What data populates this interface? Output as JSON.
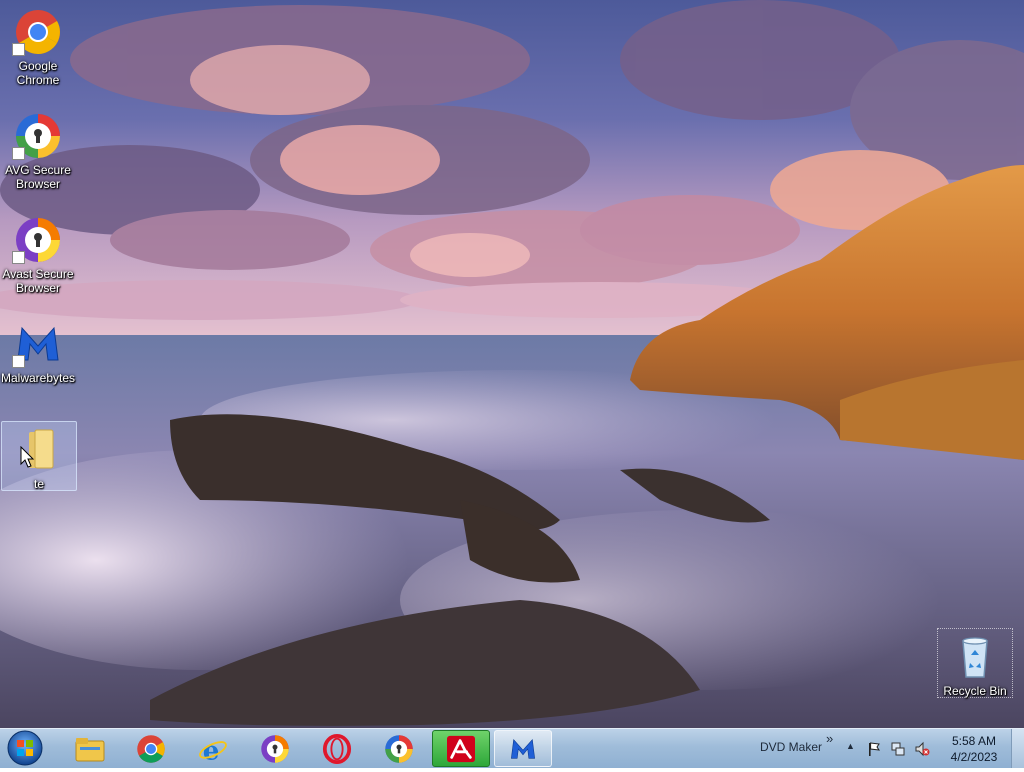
{
  "desktop": {
    "icons": [
      {
        "label": "Google\nChrome",
        "icon": "chrome-icon"
      },
      {
        "label": "AVG Secure\nBrowser",
        "icon": "avg-secure-browser-icon"
      },
      {
        "label": "Avast Secure\nBrowser",
        "icon": "avast-secure-browser-icon"
      },
      {
        "label": "Malwarebytes",
        "icon": "malwarebytes-icon"
      },
      {
        "label": "te",
        "icon": "folder-icon"
      },
      {
        "label": "Recycle Bin",
        "icon": "recycle-bin-icon"
      }
    ]
  },
  "taskbar": {
    "start": "start-orb-icon",
    "items": [
      {
        "icon": "file-explorer-icon"
      },
      {
        "icon": "chrome-icon"
      },
      {
        "icon": "internet-explorer-icon"
      },
      {
        "icon": "avast-secure-browser-icon"
      },
      {
        "icon": "opera-icon"
      },
      {
        "icon": "avg-secure-browser-icon"
      },
      {
        "icon": "avira-icon"
      },
      {
        "icon": "malwarebytes-icon"
      }
    ],
    "toolbar_label": "DVD Maker",
    "expand_glyph": "»",
    "tray_arrow": "▲",
    "clock": {
      "time": "5:58 AM",
      "date": "4/2/2023"
    }
  }
}
